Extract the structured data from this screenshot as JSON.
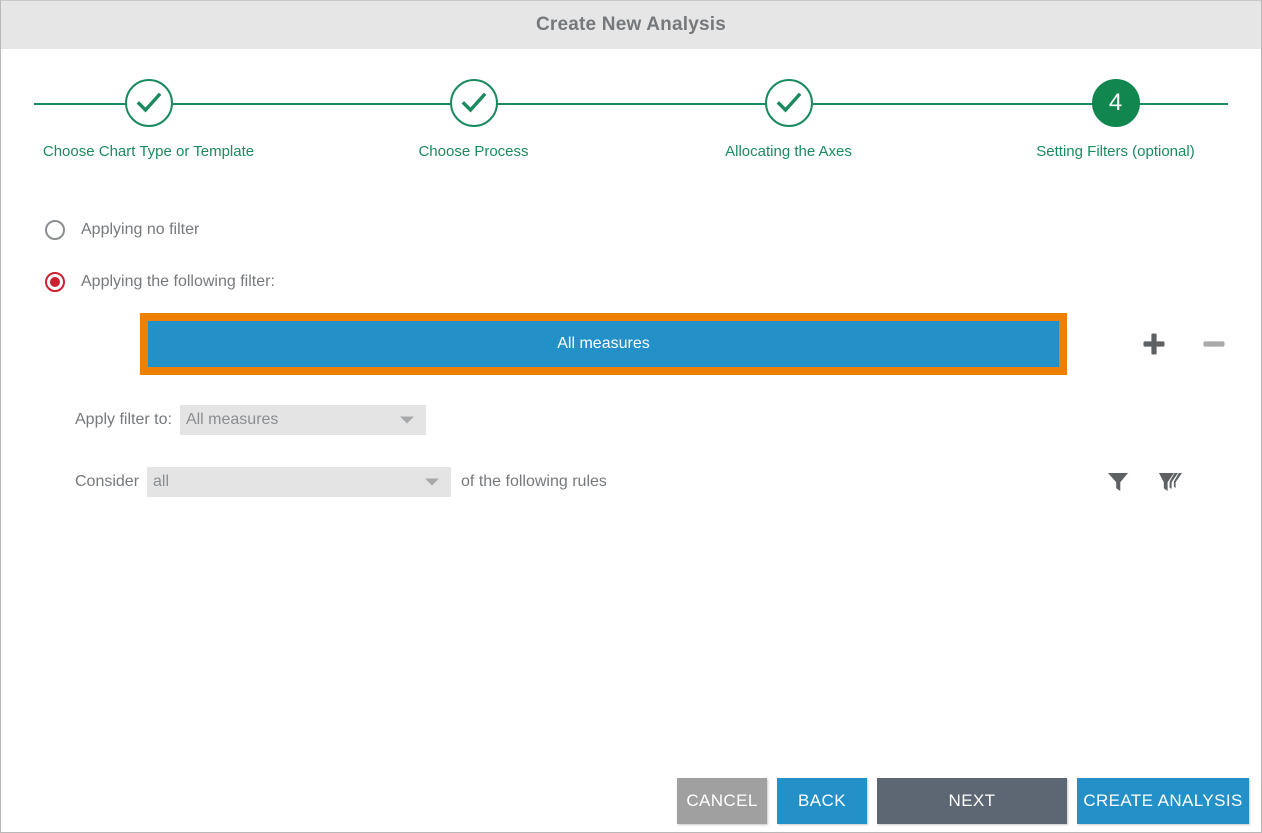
{
  "window": {
    "title": "Create New Analysis"
  },
  "stepper": {
    "steps": [
      {
        "label": "Choose Chart Type or Template",
        "state": "done",
        "marker": "check-icon"
      },
      {
        "label": "Choose Process",
        "state": "done",
        "marker": "check-icon"
      },
      {
        "label": "Allocating the Axes",
        "state": "done",
        "marker": "check-icon"
      },
      {
        "label": "Setting Filters (optional)",
        "state": "current",
        "marker": "4"
      }
    ],
    "current_number": "4",
    "accent_color": "#1a8b5f",
    "current_fill": "#11864f"
  },
  "filter_mode": {
    "options": [
      {
        "label": "Applying no filter",
        "selected": false
      },
      {
        "label": "Applying the following filter:",
        "selected": true
      }
    ],
    "selected_color": "#cc2030"
  },
  "selected_filter": {
    "chip_label": "All measures",
    "chip_color": "#2390c8",
    "highlight_color": "#ee8000",
    "add_icon": "plus-icon",
    "remove_icon": "minus-icon",
    "add_enabled": true,
    "remove_enabled": false
  },
  "apply_filter_to": {
    "label": "Apply filter to:",
    "value": "All measures",
    "arrow_icon": "chevron-down-icon"
  },
  "consider_rules": {
    "prefix_label": "Consider",
    "value": "all",
    "suffix_label": "of the following rules",
    "arrow_icon": "chevron-down-icon",
    "add_filter_icon": "funnel-icon",
    "clear_filter_icon": "funnel-clear-icon"
  },
  "footer": {
    "cancel_label": "CANCEL",
    "back_label": "BACK",
    "next_label": "NEXT",
    "create_label": "CREATE ANALYSIS"
  }
}
